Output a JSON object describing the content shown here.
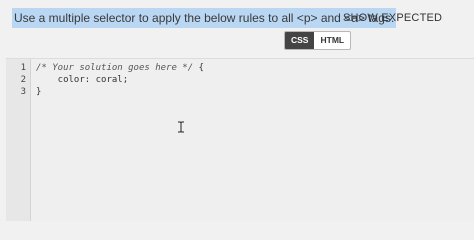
{
  "instruction": {
    "text": "Use a multiple selector to apply the below rules to all <p> and <a> tags."
  },
  "show_expected_label": "SHOW EXPECTED",
  "tabs": [
    {
      "label": "CSS",
      "active": true
    },
    {
      "label": "HTML",
      "active": false
    }
  ],
  "editor": {
    "line_numbers": [
      "1",
      "2",
      "3"
    ],
    "lines": [
      {
        "comment": "/* Your solution goes here */",
        "rest": " {"
      },
      {
        "text": "    color: coral;"
      },
      {
        "text": "}"
      }
    ]
  },
  "icons": {
    "text_cursor": "i-beam-cursor-icon"
  }
}
